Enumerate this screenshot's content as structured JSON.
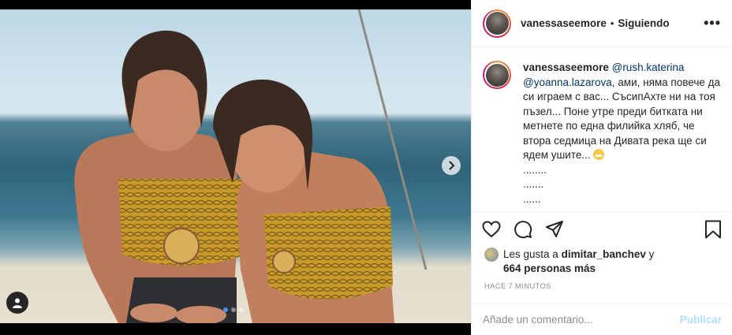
{
  "post": {
    "username": "vanessaseemore",
    "follow_status": "Siguiendo",
    "separator": "•",
    "more_label": "•••"
  },
  "caption": {
    "username": "vanessaseemore",
    "mention_1": "@rush.katerina",
    "mention_2": "@yoanna.lazarova",
    "text": ", ами, няма повече да си играем с вас... СъсипАхте ни на тоя пъзел... Поне утре преди битката ни метнете по една филийка хляб, че втора седмица на Дивата река ще си ядем ушите...",
    "ellipsis_1": "........",
    "ellipsis_2": ".......",
    "ellipsis_3": "......"
  },
  "likes": {
    "prefix": "Les gusta a",
    "liker": "dimitar_banchev",
    "connector": "y",
    "others": "664 personas más"
  },
  "timestamp": "HACE 7 MINUTOS",
  "comment": {
    "placeholder": "Añade un comentario...",
    "publish_label": "Publicar"
  },
  "carousel": {
    "slide_count": 3,
    "active_index": 0
  },
  "colors": {
    "link": "#00376b",
    "accent": "#3897f0",
    "publish_disabled": "#b2dffc",
    "muted": "#8e8e8e"
  },
  "icons": [
    "heart-icon",
    "comment-icon",
    "share-icon",
    "bookmark-icon",
    "chevron-right-icon",
    "user-tag-icon",
    "more-icon"
  ]
}
